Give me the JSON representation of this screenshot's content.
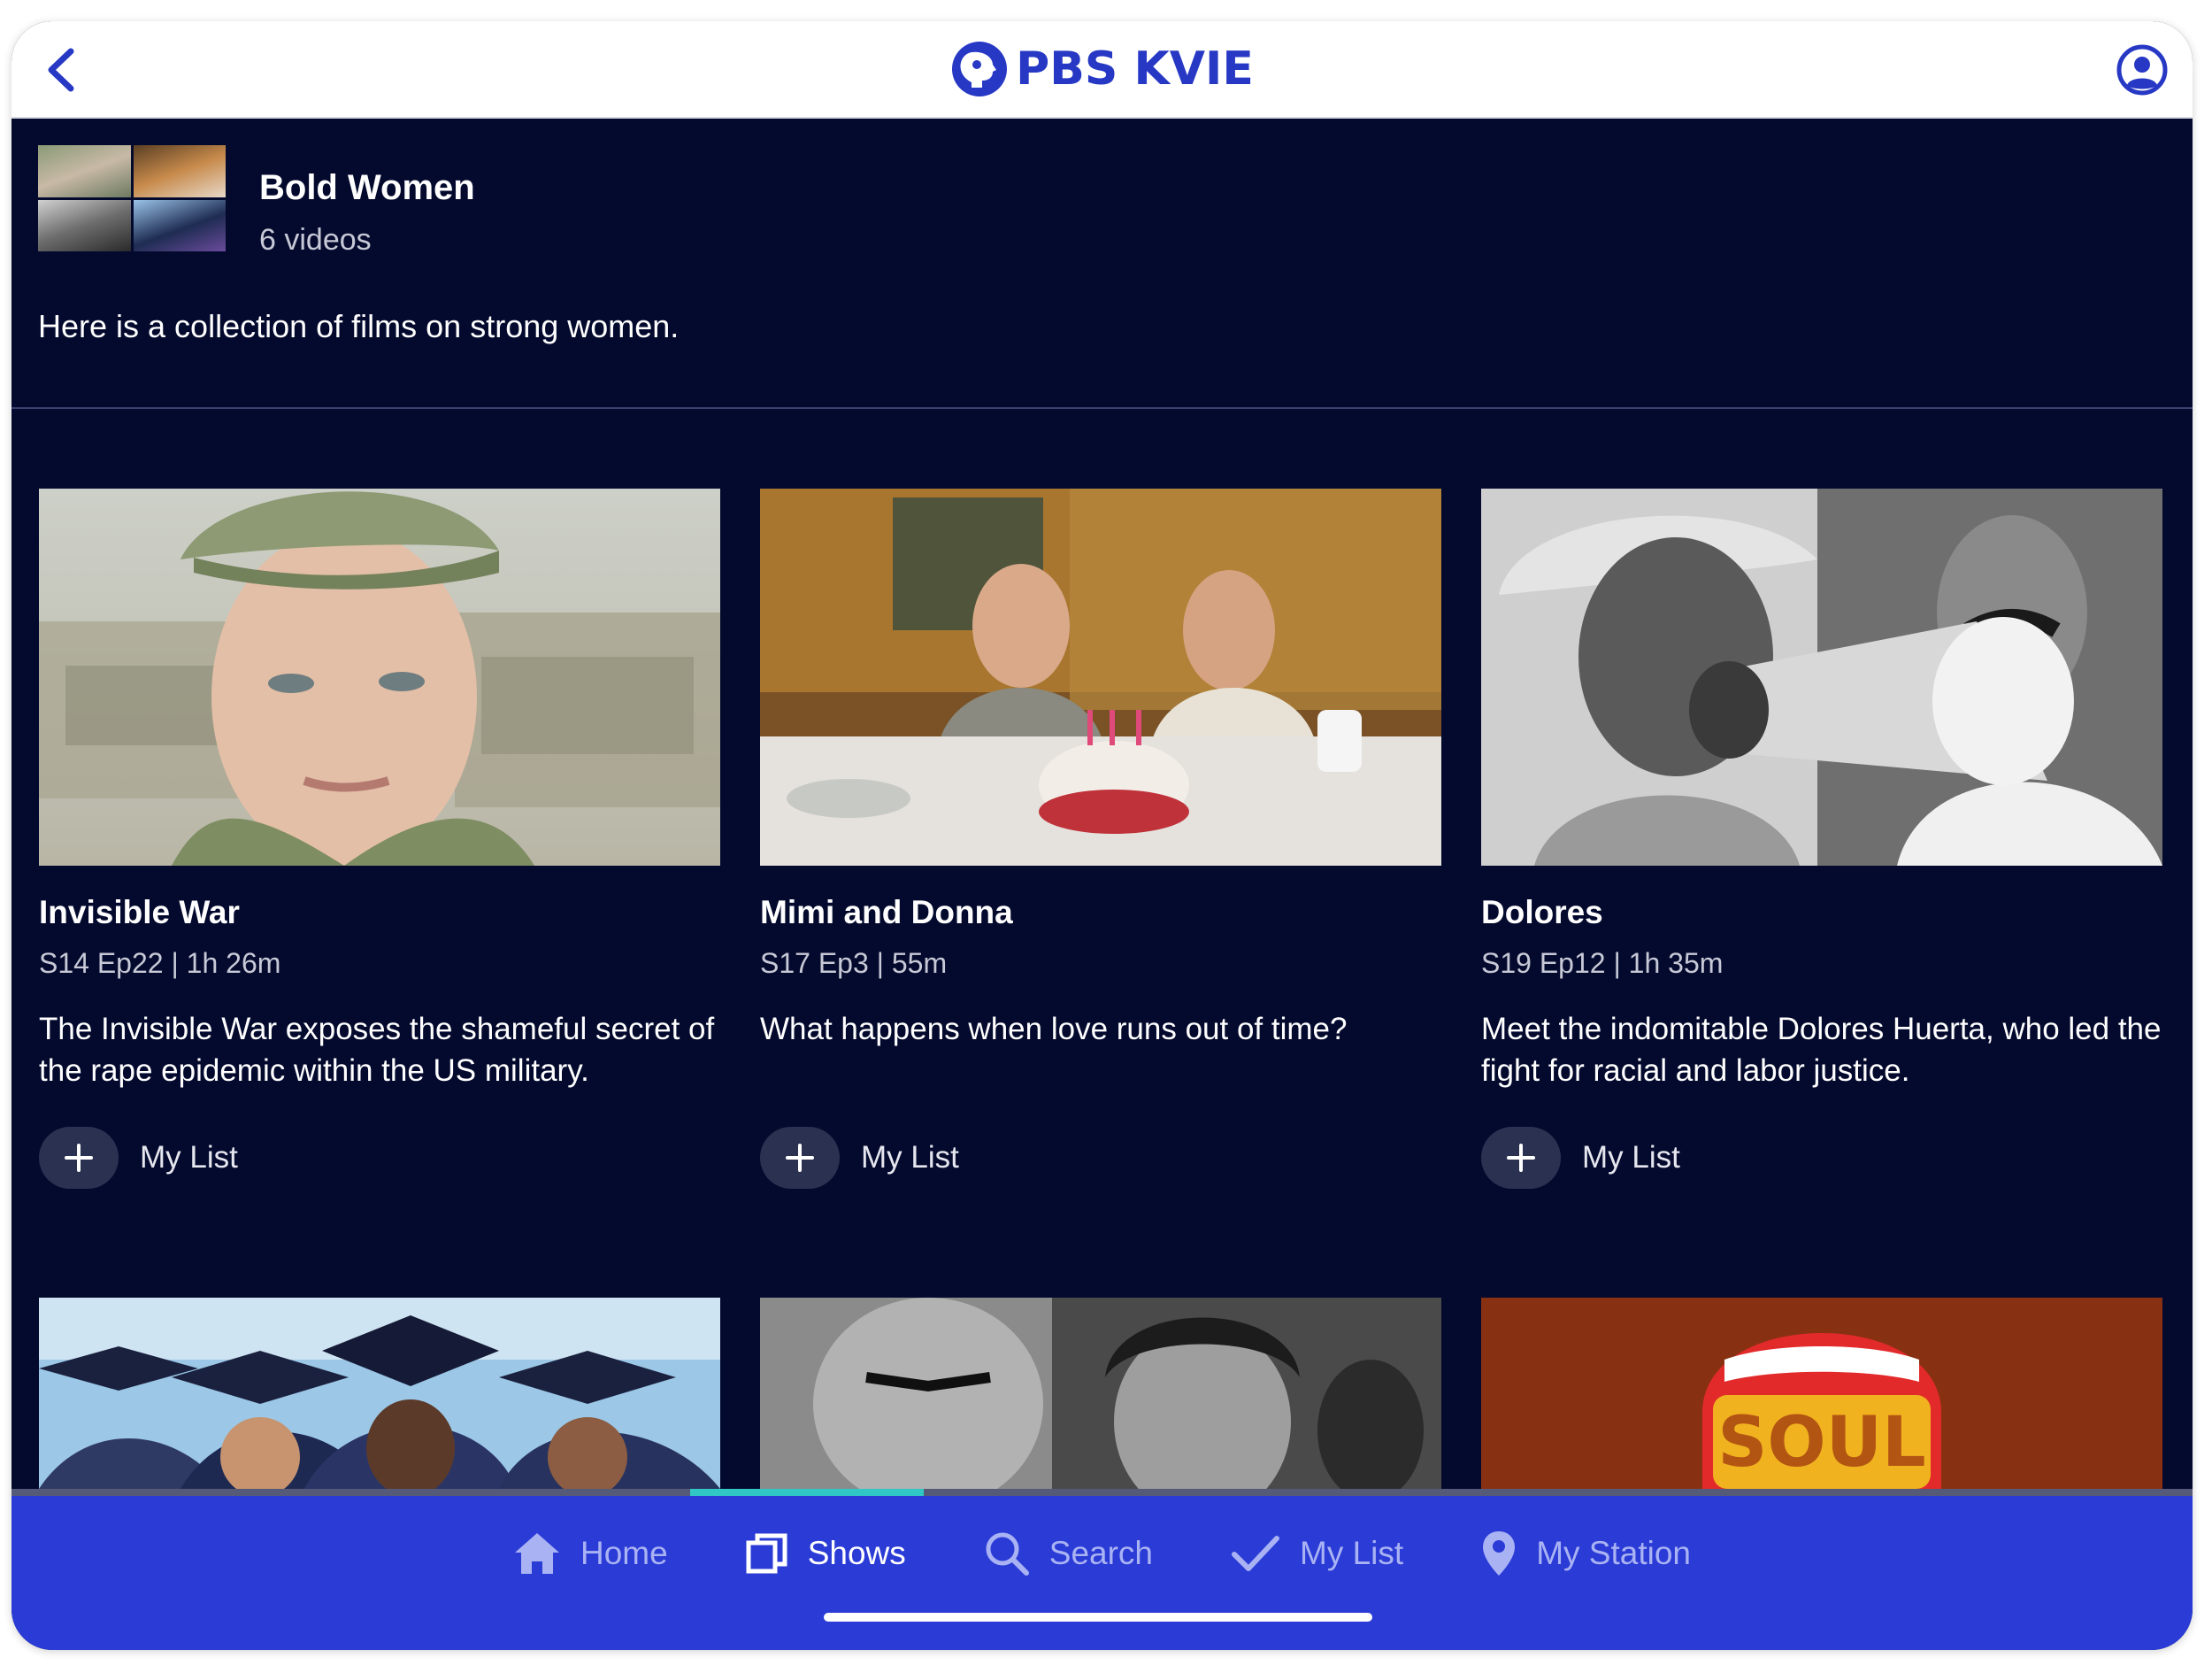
{
  "header": {
    "brand": "PBS KVIE",
    "brand_color": "#2638c4",
    "back_icon": "chevron-left-icon",
    "account_icon": "account-icon"
  },
  "collection": {
    "title": "Bold Women",
    "count": "6 videos",
    "description": "Here is a collection of films on strong women."
  },
  "videos": [
    {
      "title": "Invisible War",
      "meta": "S14 Ep22 | 1h 26m",
      "description": "The Invisible War exposes the shameful secret of the rape epidemic within the US military.",
      "action": "My List"
    },
    {
      "title": "Mimi and Donna",
      "meta": "S17 Ep3 | 55m",
      "description": "What happens when love runs out of time?",
      "action": "My List"
    },
    {
      "title": "Dolores",
      "meta": "S19 Ep12 | 1h 35m",
      "description": "Meet the indomitable Dolores Huerta, who led the fight for racial and labor justice.",
      "action": "My List"
    }
  ],
  "soul_sign": "SOUL",
  "tabbar": {
    "items": [
      {
        "label": "Home",
        "icon": "home-icon"
      },
      {
        "label": "Shows",
        "icon": "shows-icon",
        "active": true
      },
      {
        "label": "Search",
        "icon": "search-icon"
      },
      {
        "label": "My List",
        "icon": "checkmark-icon"
      },
      {
        "label": "My Station",
        "icon": "location-pin-icon"
      }
    ],
    "accent": "#31c7c4",
    "background": "#2a3bd6"
  }
}
